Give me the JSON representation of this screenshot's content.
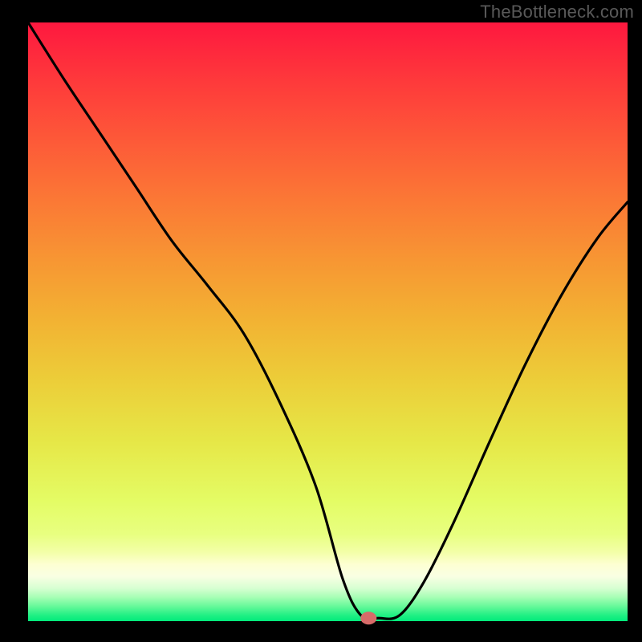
{
  "watermark": "TheBottleneck.com",
  "plot": {
    "x0": 35,
    "y0": 28,
    "x1": 782,
    "y1": 774
  },
  "gradient_stops": [
    {
      "offset": 0.0,
      "color": "#fe183f"
    },
    {
      "offset": 0.1,
      "color": "#fe3a3b"
    },
    {
      "offset": 0.2,
      "color": "#fd5a38"
    },
    {
      "offset": 0.3,
      "color": "#fb7935"
    },
    {
      "offset": 0.4,
      "color": "#f79733"
    },
    {
      "offset": 0.5,
      "color": "#f2b333"
    },
    {
      "offset": 0.6,
      "color": "#ecce39"
    },
    {
      "offset": 0.7,
      "color": "#e6e747"
    },
    {
      "offset": 0.8,
      "color": "#e4fc65"
    },
    {
      "offset": 0.855,
      "color": "#e8ff80"
    },
    {
      "offset": 0.885,
      "color": "#f3ffa8"
    },
    {
      "offset": 0.905,
      "color": "#fdffd2"
    },
    {
      "offset": 0.925,
      "color": "#f9ffe3"
    },
    {
      "offset": 0.945,
      "color": "#d7ffd2"
    },
    {
      "offset": 0.96,
      "color": "#a7feb5"
    },
    {
      "offset": 0.975,
      "color": "#67f99a"
    },
    {
      "offset": 0.99,
      "color": "#21f084"
    },
    {
      "offset": 1.0,
      "color": "#02ea7b"
    }
  ],
  "marker": {
    "color": "#d76b69",
    "cx_frac": 0.568,
    "cy_frac": 0.995,
    "rx": 10,
    "ry": 8
  },
  "chart_data": {
    "type": "line",
    "title": "",
    "xlabel": "",
    "ylabel": "",
    "xlim": [
      0,
      1
    ],
    "ylim": [
      0,
      1
    ],
    "x": [
      0.0,
      0.06,
      0.12,
      0.18,
      0.24,
      0.3,
      0.36,
      0.42,
      0.48,
      0.525,
      0.555,
      0.585,
      0.62,
      0.66,
      0.71,
      0.77,
      0.83,
      0.89,
      0.95,
      1.0
    ],
    "values": [
      1.0,
      0.905,
      0.815,
      0.725,
      0.635,
      0.56,
      0.48,
      0.365,
      0.225,
      0.07,
      0.01,
      0.005,
      0.01,
      0.065,
      0.165,
      0.3,
      0.43,
      0.545,
      0.64,
      0.7
    ],
    "marker_point": {
      "x": 0.568,
      "y": 0.005
    }
  }
}
